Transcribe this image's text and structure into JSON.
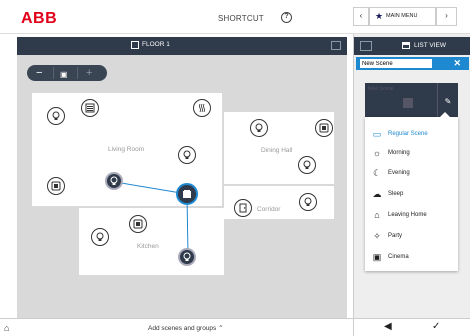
{
  "header": {
    "title": "SHORTCUT",
    "help_icon": "question-circle-icon",
    "main_menu_label": "MAIN MENU",
    "prev_label": "‹",
    "next_label": "›"
  },
  "floorplan": {
    "floor_label": "FLOOR 1",
    "zoom_out": "−",
    "zoom_in": "+",
    "rooms": {
      "living_room": "Living Room",
      "dining_hall": "Dining Hall",
      "corridor": "Corridor",
      "kitchen": "Kitchen"
    }
  },
  "right_panel": {
    "list_view_label": "LIST VIEW",
    "scene_name_value": "New Scene",
    "tile_name": "New Scene",
    "close_label": "✕",
    "scene_types": [
      {
        "label": "Regular Scene",
        "icon": "regular-scene-icon",
        "glyph": "▭"
      },
      {
        "label": "Morning",
        "icon": "morning-icon",
        "glyph": "☼"
      },
      {
        "label": "Evening",
        "icon": "evening-icon",
        "glyph": "☾"
      },
      {
        "label": "Sleep",
        "icon": "sleep-icon",
        "glyph": "☁"
      },
      {
        "label": "Leaving Home",
        "icon": "leaving-home-icon",
        "glyph": "⌂"
      },
      {
        "label": "Party",
        "icon": "party-icon",
        "glyph": "✧"
      },
      {
        "label": "Cinema",
        "icon": "cinema-icon",
        "glyph": "▣"
      }
    ]
  },
  "bottom": {
    "add_label": "Add scenes and groups ⌃",
    "back_glyph": "◀",
    "confirm_glyph": "✓"
  },
  "colors": {
    "accent": "#1e88d0",
    "dark": "#2f3a4a",
    "brand_red": "#e2001a"
  }
}
